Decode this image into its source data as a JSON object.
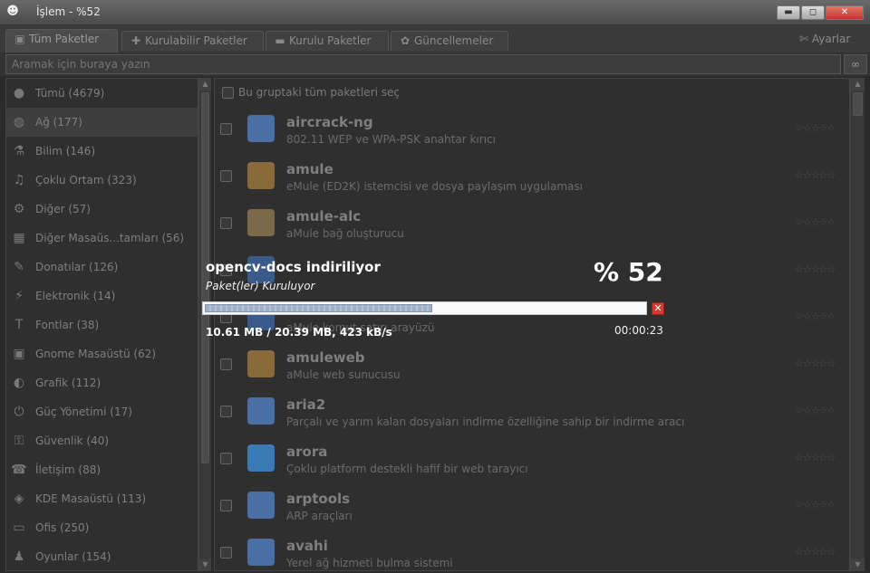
{
  "window": {
    "title": "İşlem - %52",
    "minimize_label": "▬",
    "maximize_label": "◻",
    "close_label": "✕"
  },
  "tabs": [
    {
      "label": "Tüm Paketler",
      "icon": "package-icon"
    },
    {
      "label": "Kurulabilir Paketler",
      "icon": "plus-icon"
    },
    {
      "label": "Kurulu Paketler",
      "icon": "minus-icon"
    },
    {
      "label": "Güncellemeler",
      "icon": "update-icon"
    }
  ],
  "settings_label": "Ayarlar",
  "search": {
    "placeholder": "Aramak için buraya yazın"
  },
  "categories": [
    {
      "label": "Tümü (4679)",
      "icon": "●"
    },
    {
      "label": "Ağ (177)",
      "icon": "◍",
      "selected": true
    },
    {
      "label": "Bilim (146)",
      "icon": "⚗"
    },
    {
      "label": "Çoklu Ortam (323)",
      "icon": "♫"
    },
    {
      "label": "Diğer (57)",
      "icon": "⚙"
    },
    {
      "label": "Diğer Masaüs...tamları (56)",
      "icon": "▦"
    },
    {
      "label": "Donatılar (126)",
      "icon": "✎"
    },
    {
      "label": "Elektronik (14)",
      "icon": "⚡"
    },
    {
      "label": "Fontlar (38)",
      "icon": "T"
    },
    {
      "label": "Gnome Masaüstü (62)",
      "icon": "▣"
    },
    {
      "label": "Grafik (112)",
      "icon": "◐"
    },
    {
      "label": "Güç Yönetimi (17)",
      "icon": "⏻"
    },
    {
      "label": "Güvenlik (40)",
      "icon": "⚿"
    },
    {
      "label": "İletişim (88)",
      "icon": "☎"
    },
    {
      "label": "KDE Masaüstü (113)",
      "icon": "◈"
    },
    {
      "label": "Ofis (250)",
      "icon": "▭"
    },
    {
      "label": "Oyunlar (154)",
      "icon": "♟"
    }
  ],
  "group_select_label": "Bu gruptaki tüm paketleri seç",
  "packages": [
    {
      "name": "aircrack-ng",
      "desc": "802.11 WEP ve WPA-PSK anahtar kırıcı",
      "icon_color": "#4a6fa5"
    },
    {
      "name": "amule",
      "desc": "eMule (ED2K) istemcisi ve dosya paylaşım uygulaması",
      "icon_color": "#8a6a3a"
    },
    {
      "name": "amule-alc",
      "desc": "aMule bağ oluşturucu",
      "icon_color": "#7a6a4a"
    },
    {
      "name": "",
      "desc": "",
      "icon_color": "#3a5a8a"
    },
    {
      "name": "",
      "desc": "aMule komut satırı arayüzü",
      "icon_color": "#3a5a8a"
    },
    {
      "name": "amuleweb",
      "desc": "aMule web sunucusu",
      "icon_color": "#8a6a3a"
    },
    {
      "name": "aria2",
      "desc": "Parçalı ve yarım kalan dosyaları indirme özelliğine sahip bir indirme aracı",
      "icon_color": "#4a6fa5"
    },
    {
      "name": "arora",
      "desc": "Çoklu platform destekli hafif bir web tarayıcı",
      "icon_color": "#3a7ab5"
    },
    {
      "name": "arptools",
      "desc": "ARP araçları",
      "icon_color": "#4a6fa5"
    },
    {
      "name": "avahi",
      "desc": "Yerel ağ hizmeti bulma sistemi",
      "icon_color": "#4a6fa5"
    }
  ],
  "rating_glyph": "☆☆☆☆☆",
  "download": {
    "title": "opencv-docs indiriliyor",
    "status": "Paket(ler) Kuruluyor",
    "percent_text": "% 52",
    "progress": 0.52,
    "sizes": "10.61 MB / 20.39 MB, 423 kB/s",
    "elapsed": "00:00:23",
    "cancel_label": "✕"
  }
}
